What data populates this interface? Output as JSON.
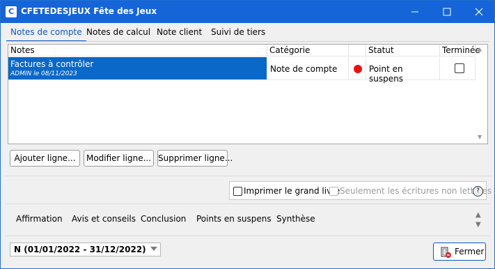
{
  "window": {
    "app_letter": "C",
    "title": "CFETEDESJEUX Fête des Jeux"
  },
  "tabs": [
    {
      "label": "Notes de compte",
      "active": true
    },
    {
      "label": "Notes de calcul",
      "active": false
    },
    {
      "label": "Note client",
      "active": false
    },
    {
      "label": "Suivi de tiers",
      "active": false
    }
  ],
  "grid": {
    "headers": {
      "notes": "Notes",
      "categorie": "Catégorie",
      "statut": "Statut",
      "terminee": "Terminée"
    },
    "rows": [
      {
        "title": "Factures à contrôler",
        "subtitle": "ADMIN le 08/11/2023",
        "categorie": "Note de compte",
        "status_color": "#e11111",
        "statut": "Point en suspens",
        "terminee": false
      }
    ]
  },
  "buttons": {
    "ajouter": "Ajouter ligne...",
    "modifier": "Modifier ligne...",
    "supprimer": "Supprimer ligne..."
  },
  "options": {
    "grand_livre": "Imprimer le grand livre",
    "non_lettrees": "Seulement les écritures non lettrées",
    "help": "?"
  },
  "bottom_tabs": [
    "Affirmation",
    "Avis et conseils",
    "Conclusion",
    "Points en suspens",
    "Synthèse"
  ],
  "period": {
    "value": "N (01/01/2022 - 31/12/2022)"
  },
  "close": {
    "label": "Fermer"
  },
  "colors": {
    "titlebar": "#1565d8",
    "selection": "#0a68c8",
    "accent": "#0a57c2"
  }
}
